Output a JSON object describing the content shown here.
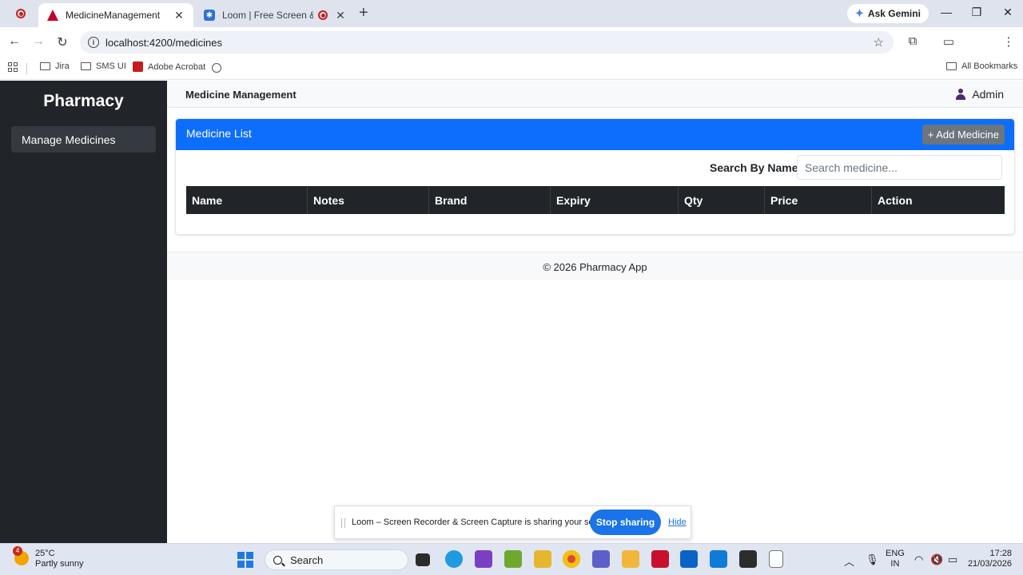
{
  "browser": {
    "tabs": [
      {
        "title": "MedicineManagement",
        "active": true
      },
      {
        "title": "Loom | Free Screen & Video Recording",
        "active": false
      }
    ],
    "close_glyph": "✕",
    "new_tab_glyph": "+",
    "ask_gemini": "Ask Gemini",
    "url": "localhost:4200/medicines",
    "bookmarks": [
      "Jira",
      "SMS UI",
      "Adobe Acrobat"
    ],
    "all_bookmarks": "All Bookmarks"
  },
  "app": {
    "sidebar": {
      "brand": "Pharmacy",
      "items": [
        {
          "label": "Manage Medicines"
        }
      ]
    },
    "header": {
      "title": "Medicine Management",
      "user": "Admin"
    },
    "card": {
      "title": "Medicine List",
      "add_button": "+ Add Medicine",
      "search_label": "Search By Name:",
      "search_placeholder": "Search medicine...",
      "columns": [
        "Name",
        "Notes",
        "Brand",
        "Expiry",
        "Qty",
        "Price",
        "Action"
      ]
    },
    "footer": "© 2026 Pharmacy App"
  },
  "loom_bar": {
    "message": "Loom – Screen Recorder & Screen Capture is sharing your screen.",
    "stop": "Stop sharing",
    "hide": "Hide"
  },
  "taskbar": {
    "weather_badge": "4",
    "temperature": "25°C",
    "condition": "Partly sunny",
    "search": "Search",
    "lang1": "ENG",
    "lang2": "IN",
    "time": "17:28",
    "date": "21/03/2026"
  },
  "colors": {
    "sidebar_bg": "#212529",
    "primary": "#0d6efd",
    "secondary_btn": "#6c757d",
    "loom_blue": "#1a73e8"
  }
}
